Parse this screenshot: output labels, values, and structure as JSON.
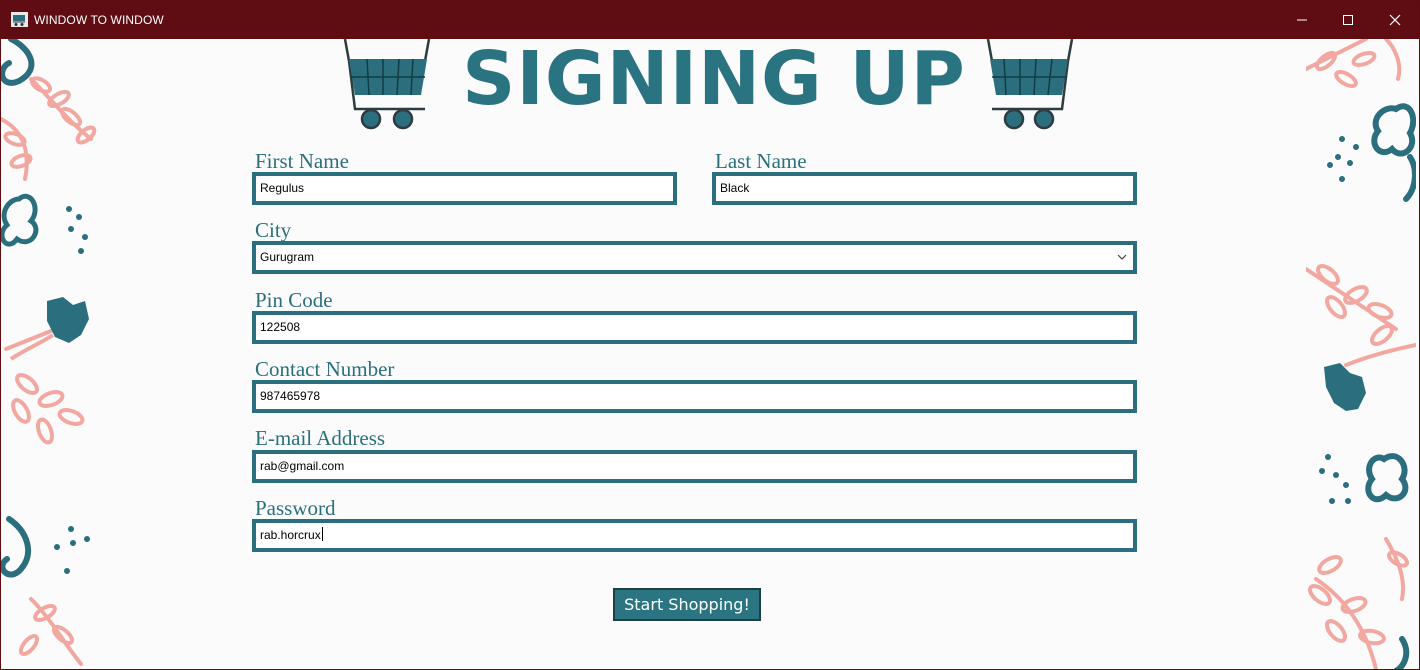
{
  "window": {
    "title": "WINDOW TO WINDOW",
    "icon": "shopping-cart-icon",
    "controls": [
      "minimize-icon",
      "maximize-icon",
      "close-icon"
    ]
  },
  "header": {
    "heading": "SIGNING UP",
    "icons": [
      "shopping-cart-icon",
      "shopping-cart-icon"
    ]
  },
  "form": {
    "first_name": {
      "label": "First Name",
      "value": "Regulus"
    },
    "last_name": {
      "label": "Last Name",
      "value": "Black"
    },
    "city": {
      "label": "City",
      "value": "Gurugram"
    },
    "pin_code": {
      "label": "Pin Code",
      "value": "122508"
    },
    "contact_number": {
      "label": "Contact Number",
      "value": "987465978"
    },
    "email": {
      "label": "E-mail Address",
      "value": "rab@gmail.com"
    },
    "password": {
      "label": "Password",
      "value": "rab.horcrux"
    }
  },
  "submit": {
    "label": "Start Shopping!"
  },
  "colors": {
    "titlebar": "#5f0d13",
    "accent_teal": "#2b6f7e",
    "floral_pink": "#f2a8a1",
    "background": "#fbfbfb"
  }
}
